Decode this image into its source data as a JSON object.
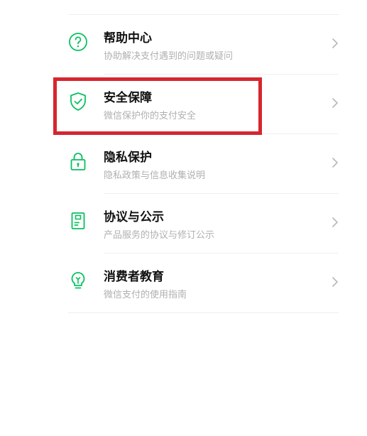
{
  "menu": {
    "items": [
      {
        "title": "帮助中心",
        "subtitle": "协助解决支付遇到的问题或疑问",
        "icon": "help-circle-icon"
      },
      {
        "title": "安全保障",
        "subtitle": "微信保护你的支付安全",
        "icon": "shield-check-icon"
      },
      {
        "title": "隐私保护",
        "subtitle": "隐私政策与信息收集说明",
        "icon": "lock-icon"
      },
      {
        "title": "协议与公示",
        "subtitle": "产品服务的协议与修订公示",
        "icon": "document-icon"
      },
      {
        "title": "消费者教育",
        "subtitle": "微信支付的使用指南",
        "icon": "lightbulb-icon"
      }
    ]
  },
  "colors": {
    "accent": "#07c160",
    "highlight_border": "#d6262e",
    "title_text": "#111111",
    "subtitle_text": "#b0b0b0",
    "chevron": "#b8b8b8"
  }
}
